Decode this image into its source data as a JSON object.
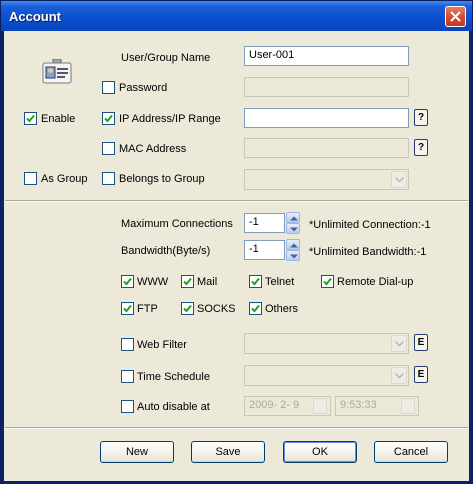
{
  "window": {
    "title": "Account"
  },
  "labels": {
    "user_group_name": "User/Group Name",
    "password": "Password",
    "enable": "Enable",
    "ip_range": "IP Address/IP Range",
    "mac_address": "MAC Address",
    "as_group": "As Group",
    "belongs_to_group": "Belongs to Group",
    "max_connections": "Maximum Connections",
    "bandwidth": "Bandwidth(Byte/s)",
    "unlimited_connection": "*Unlimited Connection:-1",
    "unlimited_bandwidth": "*Unlimited Bandwidth:-1",
    "web_filter": "Web Filter",
    "time_schedule": "Time Schedule",
    "auto_disable": "Auto disable at"
  },
  "fields": {
    "user_group_name": "User-001",
    "max_connections": "-1",
    "bandwidth": "-1",
    "auto_disable_date": "2009- 2- 9",
    "auto_disable_time": "9:53:33"
  },
  "checkboxes": {
    "password": false,
    "enable": true,
    "ip_range": true,
    "mac_address": false,
    "as_group": false,
    "belongs_to_group": false,
    "web_filter": false,
    "time_schedule": false,
    "auto_disable": false
  },
  "services": [
    {
      "label": "WWW",
      "checked": true
    },
    {
      "label": "Mail",
      "checked": true
    },
    {
      "label": "Telnet",
      "checked": true
    },
    {
      "label": "Remote Dial-up",
      "checked": true
    },
    {
      "label": "FTP",
      "checked": true
    },
    {
      "label": "SOCKS",
      "checked": true
    },
    {
      "label": "Others",
      "checked": true
    }
  ],
  "small_buttons": {
    "help": "?",
    "edit": "E"
  },
  "buttons": {
    "new": "New",
    "save": "Save",
    "ok": "OK",
    "cancel": "Cancel"
  }
}
